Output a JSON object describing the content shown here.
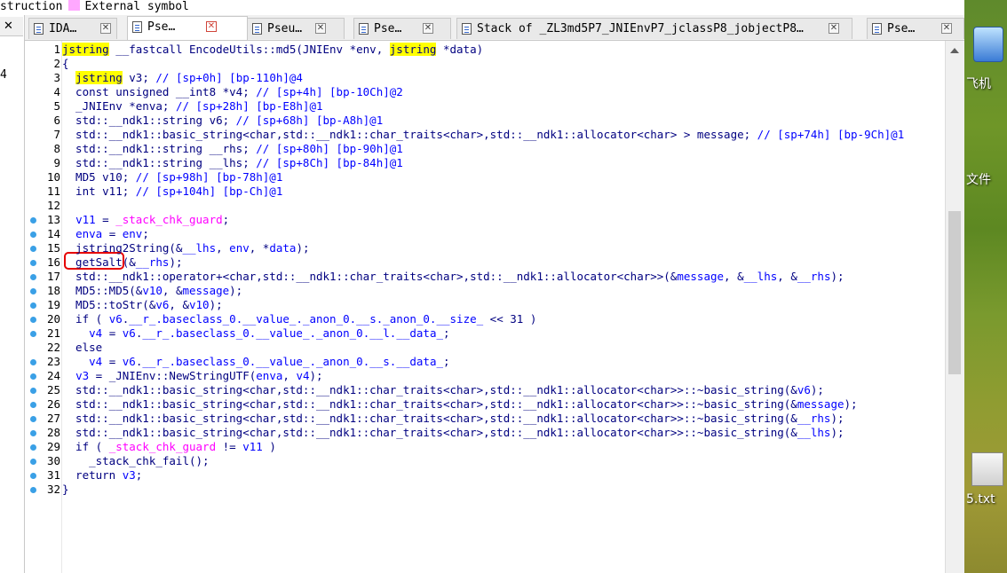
{
  "legend": {
    "prefix": "struction",
    "label": "External symbol"
  },
  "left_panel": {
    "close_glyph": "✕",
    "line_number": "4"
  },
  "tabs": [
    {
      "label": "IDA…",
      "close": "✕"
    },
    {
      "label": "Pse…",
      "close": "✕"
    },
    {
      "label": "Pseu…",
      "close": "✕"
    },
    {
      "label": "Pse…",
      "close": "✕"
    },
    {
      "label": "Stack of _ZL3md5P7_JNIEnvP7_jclassP8_jobjectP8…",
      "close": "✕"
    },
    {
      "label": "Pse…",
      "close": "✕"
    }
  ],
  "code": [
    {
      "n": "1",
      "bp": false,
      "hl": true,
      "tokens": [
        [
          "kw",
          "jstring"
        ],
        [
          "t-n",
          " __fastcall EncodeUtils::md5(JNIEnv *env, "
        ],
        [
          "kw",
          "jstring"
        ],
        [
          "t-n",
          " *data)"
        ]
      ]
    },
    {
      "n": "2",
      "bp": false,
      "tokens": [
        [
          "t-n",
          "{"
        ]
      ]
    },
    {
      "n": "3",
      "bp": false,
      "tokens": [
        [
          "t-n",
          "  "
        ],
        [
          "kw",
          "jstring"
        ],
        [
          "t-n",
          " v3; "
        ],
        [
          "t-c",
          "// [sp+0h] [bp-110h]@4"
        ]
      ]
    },
    {
      "n": "4",
      "bp": false,
      "tokens": [
        [
          "t-n",
          "  const unsigned __int8 *v4; "
        ],
        [
          "t-c",
          "// [sp+4h] [bp-10Ch]@2"
        ]
      ]
    },
    {
      "n": "5",
      "bp": false,
      "tokens": [
        [
          "t-n",
          "  _JNIEnv *enva; "
        ],
        [
          "t-c",
          "// [sp+28h] [bp-E8h]@1"
        ]
      ]
    },
    {
      "n": "6",
      "bp": false,
      "tokens": [
        [
          "t-n",
          "  std::__ndk1::string v6; "
        ],
        [
          "t-c",
          "// [sp+68h] [bp-A8h]@1"
        ]
      ]
    },
    {
      "n": "7",
      "bp": false,
      "tokens": [
        [
          "t-n",
          "  std::__ndk1::basic_string<char,std::__ndk1::char_traits<char>,std::__ndk1::allocator<char> > message; "
        ],
        [
          "t-c",
          "// [sp+74h] [bp-9Ch]@1"
        ]
      ]
    },
    {
      "n": "8",
      "bp": false,
      "tokens": [
        [
          "t-n",
          "  std::__ndk1::string __rhs; "
        ],
        [
          "t-c",
          "// [sp+80h] [bp-90h]@1"
        ]
      ]
    },
    {
      "n": "9",
      "bp": false,
      "tokens": [
        [
          "t-n",
          "  std::__ndk1::string __lhs; "
        ],
        [
          "t-c",
          "// [sp+8Ch] [bp-84h]@1"
        ]
      ]
    },
    {
      "n": "10",
      "bp": false,
      "tokens": [
        [
          "t-n",
          "  MD5 v10; "
        ],
        [
          "t-c",
          "// [sp+98h] [bp-78h]@1"
        ]
      ]
    },
    {
      "n": "11",
      "bp": false,
      "tokens": [
        [
          "t-n",
          "  int v11; "
        ],
        [
          "t-c",
          "// [sp+104h] [bp-Ch]@1"
        ]
      ]
    },
    {
      "n": "12",
      "bp": false,
      "tokens": [
        [
          "t-n",
          ""
        ]
      ]
    },
    {
      "n": "13",
      "bp": true,
      "tokens": [
        [
          "t-n",
          "  "
        ],
        [
          "t-v",
          "v11"
        ],
        [
          "t-n",
          " = "
        ],
        [
          "t-s",
          "_stack_chk_guard"
        ],
        [
          "t-n",
          ";"
        ]
      ]
    },
    {
      "n": "14",
      "bp": true,
      "tokens": [
        [
          "t-n",
          "  "
        ],
        [
          "t-v",
          "enva"
        ],
        [
          "t-n",
          " = "
        ],
        [
          "t-v",
          "env"
        ],
        [
          "t-n",
          ";"
        ]
      ]
    },
    {
      "n": "15",
      "bp": true,
      "tokens": [
        [
          "t-n",
          "  jstring2String(&"
        ],
        [
          "t-v",
          "__lhs"
        ],
        [
          "t-n",
          ", "
        ],
        [
          "t-v",
          "env"
        ],
        [
          "t-n",
          ", *"
        ],
        [
          "t-v",
          "data"
        ],
        [
          "t-n",
          ");"
        ]
      ]
    },
    {
      "n": "16",
      "bp": true,
      "tokens": [
        [
          "t-n",
          "  getSalt(&"
        ],
        [
          "t-v",
          "__rhs"
        ],
        [
          "t-n",
          ");"
        ]
      ]
    },
    {
      "n": "17",
      "bp": true,
      "tokens": [
        [
          "t-n",
          "  std::__ndk1::operator+<char,std::__ndk1::char_traits<char>,std::__ndk1::allocator<char>>(&"
        ],
        [
          "t-v",
          "message"
        ],
        [
          "t-n",
          ", &"
        ],
        [
          "t-v",
          "__lhs"
        ],
        [
          "t-n",
          ", &"
        ],
        [
          "t-v",
          "__rhs"
        ],
        [
          "t-n",
          ");"
        ]
      ]
    },
    {
      "n": "18",
      "bp": true,
      "tokens": [
        [
          "t-n",
          "  MD5::MD5(&"
        ],
        [
          "t-v",
          "v10"
        ],
        [
          "t-n",
          ", &"
        ],
        [
          "t-v",
          "message"
        ],
        [
          "t-n",
          ");"
        ]
      ]
    },
    {
      "n": "19",
      "bp": true,
      "tokens": [
        [
          "t-n",
          "  MD5::toStr(&"
        ],
        [
          "t-v",
          "v6"
        ],
        [
          "t-n",
          ", &"
        ],
        [
          "t-v",
          "v10"
        ],
        [
          "t-n",
          ");"
        ]
      ]
    },
    {
      "n": "20",
      "bp": true,
      "tokens": [
        [
          "t-n",
          "  if ( "
        ],
        [
          "t-v",
          "v6"
        ],
        [
          "t-n",
          "."
        ],
        [
          "t-v",
          "__r_.baseclass_0.__value_._anon_0.__s._anon_0.__size_"
        ],
        [
          "t-n",
          " << 31 )"
        ]
      ]
    },
    {
      "n": "21",
      "bp": true,
      "tokens": [
        [
          "t-n",
          "    "
        ],
        [
          "t-v",
          "v4"
        ],
        [
          "t-n",
          " = "
        ],
        [
          "t-v",
          "v6"
        ],
        [
          "t-n",
          "."
        ],
        [
          "t-v",
          "__r_.baseclass_0.__value_._anon_0.__l.__data_"
        ],
        [
          "t-n",
          ";"
        ]
      ]
    },
    {
      "n": "22",
      "bp": false,
      "tokens": [
        [
          "t-n",
          "  else"
        ]
      ]
    },
    {
      "n": "23",
      "bp": true,
      "tokens": [
        [
          "t-n",
          "    "
        ],
        [
          "t-v",
          "v4"
        ],
        [
          "t-n",
          " = "
        ],
        [
          "t-v",
          "v6"
        ],
        [
          "t-n",
          "."
        ],
        [
          "t-v",
          "__r_.baseclass_0.__value_._anon_0.__s.__data_"
        ],
        [
          "t-n",
          ";"
        ]
      ]
    },
    {
      "n": "24",
      "bp": true,
      "tokens": [
        [
          "t-n",
          "  "
        ],
        [
          "t-v",
          "v3"
        ],
        [
          "t-n",
          " = _JNIEnv::NewStringUTF("
        ],
        [
          "t-v",
          "enva"
        ],
        [
          "t-n",
          ", "
        ],
        [
          "t-v",
          "v4"
        ],
        [
          "t-n",
          ");"
        ]
      ]
    },
    {
      "n": "25",
      "bp": true,
      "tokens": [
        [
          "t-n",
          "  std::__ndk1::basic_string<char,std::__ndk1::char_traits<char>,std::__ndk1::allocator<char>>::~basic_string(&"
        ],
        [
          "t-v",
          "v6"
        ],
        [
          "t-n",
          ");"
        ]
      ]
    },
    {
      "n": "26",
      "bp": true,
      "tokens": [
        [
          "t-n",
          "  std::__ndk1::basic_string<char,std::__ndk1::char_traits<char>,std::__ndk1::allocator<char>>::~basic_string(&"
        ],
        [
          "t-v",
          "message"
        ],
        [
          "t-n",
          ");"
        ]
      ]
    },
    {
      "n": "27",
      "bp": true,
      "tokens": [
        [
          "t-n",
          "  std::__ndk1::basic_string<char,std::__ndk1::char_traits<char>,std::__ndk1::allocator<char>>::~basic_string(&"
        ],
        [
          "t-v",
          "__rhs"
        ],
        [
          "t-n",
          ");"
        ]
      ]
    },
    {
      "n": "28",
      "bp": true,
      "tokens": [
        [
          "t-n",
          "  std::__ndk1::basic_string<char,std::__ndk1::char_traits<char>,std::__ndk1::allocator<char>>::~basic_string(&"
        ],
        [
          "t-v",
          "__lhs"
        ],
        [
          "t-n",
          ");"
        ]
      ]
    },
    {
      "n": "29",
      "bp": true,
      "tokens": [
        [
          "t-n",
          "  if ( "
        ],
        [
          "t-s",
          "_stack_chk_guard"
        ],
        [
          "t-n",
          " != "
        ],
        [
          "t-v",
          "v11"
        ],
        [
          "t-n",
          " )"
        ]
      ]
    },
    {
      "n": "30",
      "bp": true,
      "tokens": [
        [
          "t-n",
          "    _stack_chk_fail();"
        ]
      ]
    },
    {
      "n": "31",
      "bp": true,
      "tokens": [
        [
          "t-n",
          "  return "
        ],
        [
          "t-v",
          "v3"
        ],
        [
          "t-n",
          ";"
        ]
      ]
    },
    {
      "n": "32",
      "bp": true,
      "tokens": [
        [
          "t-n",
          "}"
        ]
      ]
    }
  ],
  "desktop": {
    "labels": [
      "飞机",
      "文件",
      "5.txt"
    ]
  },
  "colors": {
    "keyword_highlight": "#ffff00",
    "comment": "#0000ff",
    "variable": "#0000ff",
    "global": "#ff00ff",
    "plain": "#000080",
    "breakpoint": "#3aa0e6",
    "annotation_box": "#e60000"
  }
}
